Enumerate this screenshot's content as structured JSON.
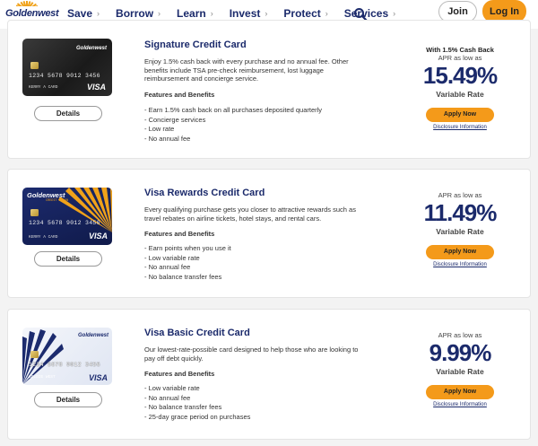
{
  "header": {
    "logo_text": "Goldenwest",
    "logo_subtext": "CREDIT UNION",
    "nav": [
      {
        "label": "Save"
      },
      {
        "label": "Borrow"
      },
      {
        "label": "Learn"
      },
      {
        "label": "Invest"
      },
      {
        "label": "Protect"
      },
      {
        "label": "Services"
      }
    ],
    "join_label": "Join",
    "login_label": "Log In"
  },
  "cards": [
    {
      "title": "Signature Credit Card",
      "description": "Enjoy 1.5% cash back with every purchase and no annual fee. Other benefits include TSA pre-check reimbursement, lost luggage reimbursement and concierge service.",
      "features_heading": "Features and Benefits",
      "features": [
        "- Earn 1.5% cash back on all purchases deposited quarterly",
        "- Concierge services",
        "- Low rate",
        "- No annual fee"
      ],
      "promo": "With 1.5% Cash Back",
      "apr_label": "APR as low as",
      "rate": "15.49%",
      "rate_type": "Variable Rate",
      "apply_label": "Apply Now",
      "disclosure_label": "Disclosure Information",
      "details_label": "Details",
      "card_number": "1234 5678 9012 3456",
      "card_name": "KERRY A CARD",
      "card_brand": "Goldenwest",
      "network": "VISA"
    },
    {
      "title": "Visa Rewards Credit Card",
      "description": "Every qualifying purchase gets you closer to attractive rewards such as travel rebates on airline tickets, hotel stays, and rental cars.",
      "features_heading": "Features and Benefits",
      "features": [
        "- Earn points when you use it",
        "- Low variable rate",
        "- No annual fee",
        "- No balance transfer fees"
      ],
      "promo": "",
      "apr_label": "APR as low as",
      "rate": "11.49%",
      "rate_type": "Variable Rate",
      "apply_label": "Apply Now",
      "disclosure_label": "Disclosure Information",
      "details_label": "Details",
      "card_number": "1234 5678 9012 3456",
      "card_name": "KERRY A CARD",
      "card_brand": "Goldenwest",
      "card_brand_sub": "CREDIT UNION",
      "network": "VISA"
    },
    {
      "title": "Visa Basic Credit Card",
      "description": "Our lowest-rate-possible card designed to help those who are looking to pay off debt quickly.",
      "features_heading": "Features and Benefits",
      "features": [
        "- Low variable rate",
        "- No annual fee",
        "- No balance transfer fees",
        "- 25-day grace period on purchases"
      ],
      "promo": "",
      "apr_label": "APR as low as",
      "rate": "9.99%",
      "rate_type": "Variable Rate",
      "apply_label": "Apply Now",
      "disclosure_label": "Disclosure Information",
      "details_label": "Details",
      "card_number": "1234 5678 9012 3456",
      "card_name": "GOLDIE WEST",
      "card_brand": "Goldenwest",
      "network": "VISA"
    }
  ],
  "colors": {
    "brand_navy": "#1b2a6b",
    "accent_orange": "#f49a1a"
  },
  "icons": {
    "search": "search-icon",
    "chevron": "chevron-right-icon"
  }
}
